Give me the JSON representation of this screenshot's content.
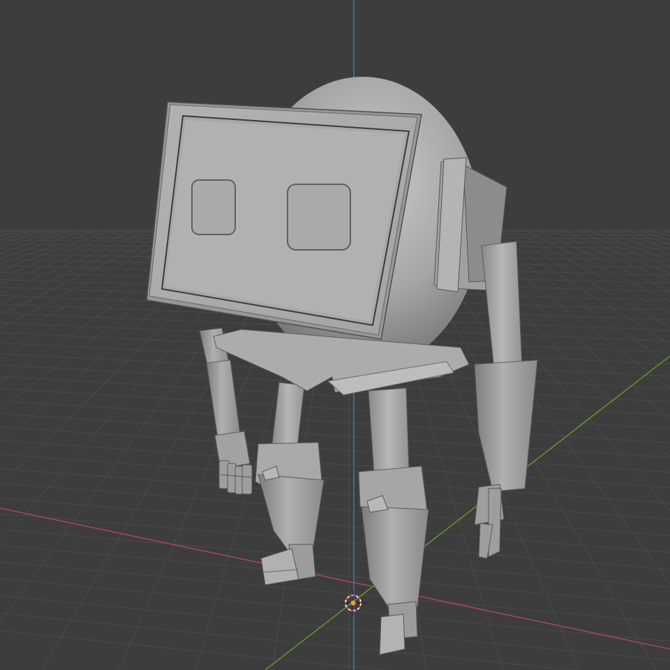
{
  "viewport": {
    "background_color": "#3d3d3d",
    "grid_color": "#4a4a4a",
    "x_axis_color": "#b3485a",
    "y_axis_color": "#6b9b2e",
    "z_axis_color": "#3b7ad1",
    "model_color": "#9a9a9a",
    "cursor_icon": "3d-cursor-icon"
  }
}
